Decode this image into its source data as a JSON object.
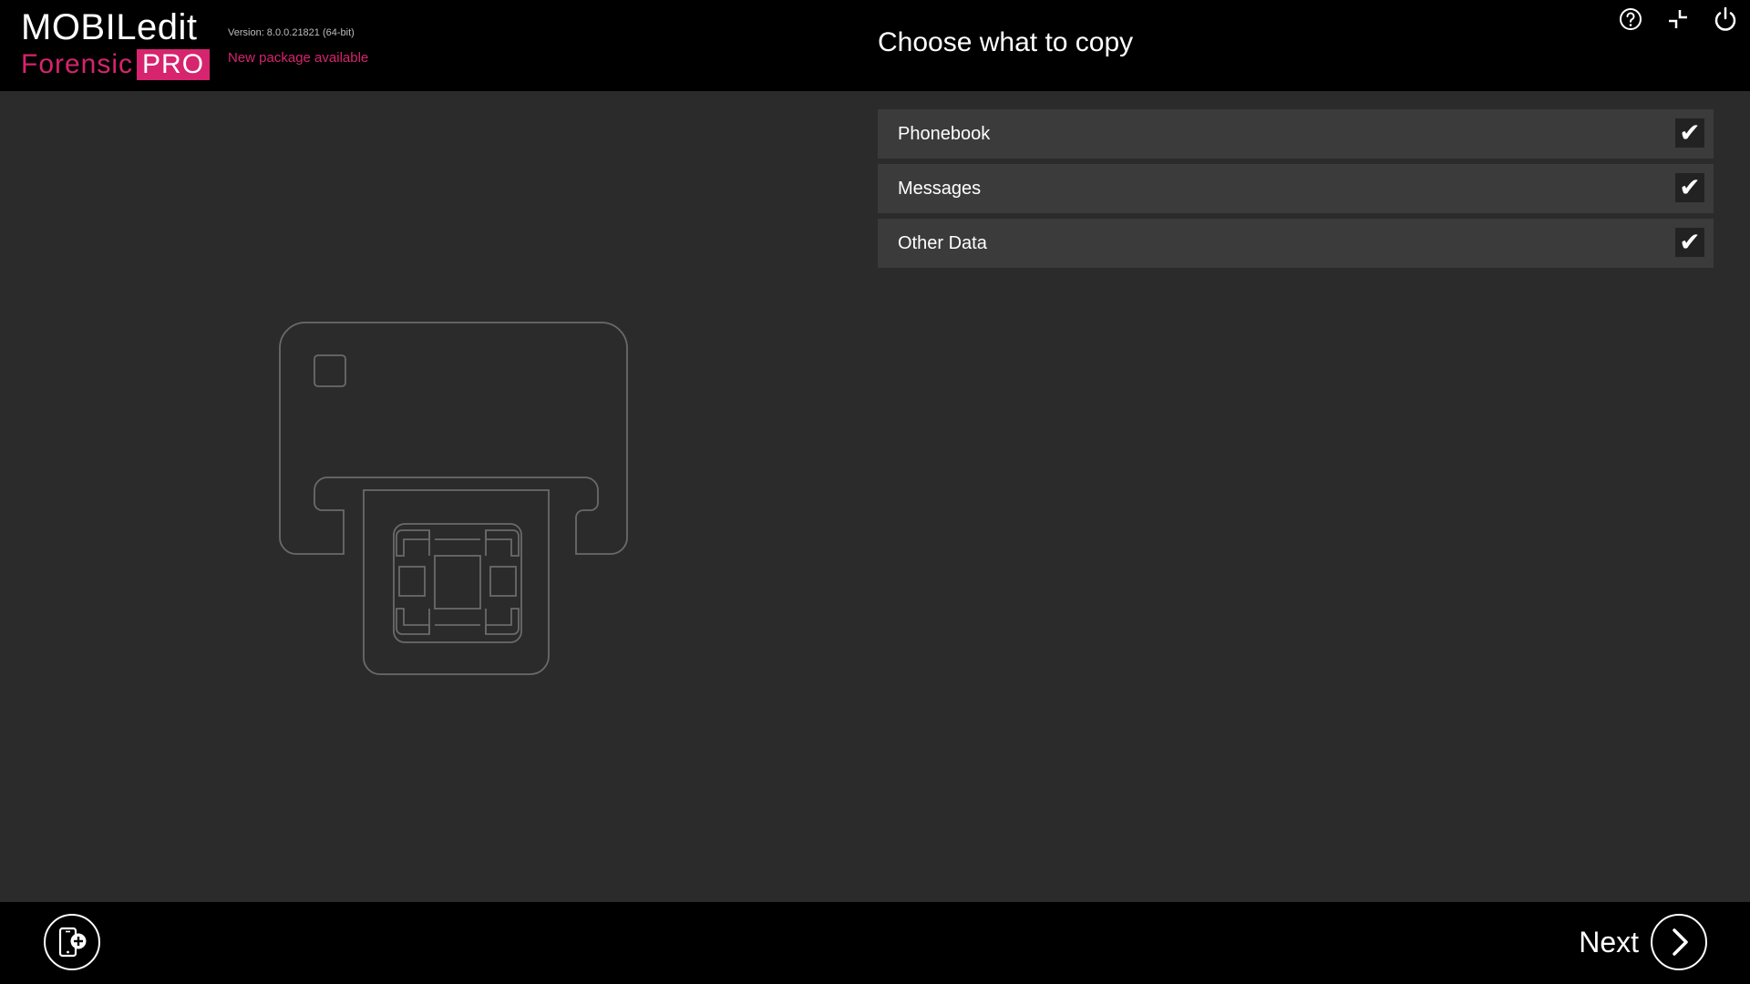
{
  "app": {
    "logo_top": "MOBILedit",
    "logo_bottom": "Forensic",
    "logo_badge": "PRO",
    "version": "Version: 8.0.0.21821 (64-bit)",
    "update_notice": "New package available",
    "brand_color": "#d6246e"
  },
  "header": {
    "title": "Choose what to copy",
    "icons": [
      "help-icon",
      "minimize-icon",
      "power-icon"
    ]
  },
  "options": [
    {
      "label": "Phonebook",
      "checked": true
    },
    {
      "label": "Messages",
      "checked": true
    },
    {
      "label": "Other Data",
      "checked": true
    }
  ],
  "check_glyph": "✔",
  "footer": {
    "add_device_icon": "add-device-icon",
    "next_label": "Next",
    "next_icon": "chevron-right-icon"
  }
}
